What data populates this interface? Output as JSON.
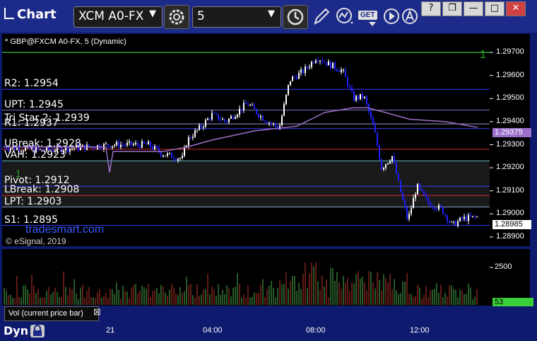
{
  "app": {
    "title": "Chart"
  },
  "toolbar": {
    "symbol": "XCM A0-FX",
    "interval": "5",
    "symbol_arrow": "▼",
    "interval_arrow": "▼",
    "get_label": "GET"
  },
  "window_buttons": {
    "help": "?",
    "restore": "❐",
    "minimize": "—",
    "maximize": "□",
    "close": "✕"
  },
  "chart": {
    "title": "* GBP@FXCM A0-FX, 5 (Dynamic)",
    "watermark": "tradesmart.com",
    "copyright": "© eSignal, 2019",
    "level_marker": "1",
    "level_marker_left": "1",
    "price_ticks": [
      "1.29700",
      "1.29600",
      "1.29500",
      "1.29400",
      "1.29300",
      "1.29200",
      "1.29100",
      "1.29000",
      "1.28900"
    ],
    "current_price_label": "1.29375",
    "last_price_label": "1.28985",
    "time_ticks": [
      "21",
      "04:00",
      "08:00",
      "12:00"
    ],
    "levels": [
      {
        "name": "R2",
        "label": "R2: 1.2954",
        "value": 1.2954,
        "color": "#3b3bff"
      },
      {
        "name": "UPT",
        "label": "UPT: 1.2945",
        "value": 1.2945,
        "color": "#7a78c8"
      },
      {
        "name": "TriStar",
        "label": "Tri Star 2: 1.2939",
        "value": 1.2939,
        "color": "#9a98c8"
      },
      {
        "name": "R1",
        "label": "R1: 1.2937",
        "value": 1.2937,
        "color": "#3b3bff"
      },
      {
        "name": "UBreak",
        "label": "UBreak: 1.2928",
        "value": 1.2928,
        "color": "#d03030"
      },
      {
        "name": "VAH",
        "label": "VAH: 1.2923",
        "value": 1.2923,
        "color": "#60c0c0"
      },
      {
        "name": "Pivot",
        "label": "Pivot: 1.2912",
        "value": 1.2912,
        "color": "#3b3bff"
      },
      {
        "name": "LBreak",
        "label": "LBreak: 1.2908",
        "value": 1.2908,
        "color": "#d03030"
      },
      {
        "name": "LPT",
        "label": "LPT: 1.2903",
        "value": 1.2903,
        "color": "#8aa0d0"
      },
      {
        "name": "S1",
        "label": "S1: 1.2895",
        "value": 1.2895,
        "color": "#3b3bff"
      }
    ]
  },
  "volume": {
    "tag": "Vol (current price bar)",
    "tag_close": "⊠",
    "tick": "2500",
    "last_label": "53"
  },
  "bottom": {
    "dyn_label": "Dyn"
  },
  "colors": {
    "up": "#ffffff",
    "down": "#2020ff",
    "avg": "#9b6fc9",
    "green_line": "#2aa02a",
    "vol_up": "#4caf50",
    "vol_down": "#c0392b",
    "current_label_bg": "#9b6fc9",
    "last_label_bg": "#ffffff",
    "vol_last_bg": "#3ad03a"
  }
}
